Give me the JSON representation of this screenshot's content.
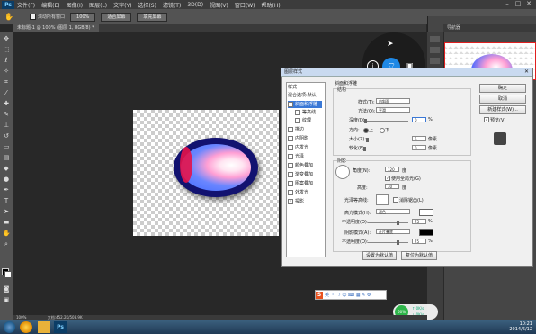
{
  "menubar": {
    "logo": "Ps",
    "items": [
      "文件(F)",
      "编辑(E)",
      "图像(I)",
      "图层(L)",
      "文字(Y)",
      "选择(S)",
      "滤镜(T)",
      "3D(D)",
      "视图(V)",
      "窗口(W)",
      "帮助(H)"
    ],
    "win_controls": [
      "–",
      "□",
      "✕"
    ]
  },
  "options": {
    "hand_icon": "hand-icon",
    "scroll_all_label": "滚动所有窗口",
    "zoom100": "100%",
    "fit_screen": "适合屏幕",
    "fill_screen": "填充屏幕"
  },
  "document": {
    "tab_title": "未标题-1 @ 100% (图层 1, RGB/8) *",
    "zoom": "100%",
    "doc_info": "文档:452.2K/508.9K"
  },
  "panel": {
    "title": "导航器"
  },
  "dialog": {
    "title": "图层样式",
    "styles_header": "样式",
    "blend_default": "混合选项:默认",
    "items": [
      {
        "label": "斜面和浮雕",
        "checked": true,
        "selected": true
      },
      {
        "label": "等高线",
        "checked": false
      },
      {
        "label": "纹理",
        "checked": false
      },
      {
        "label": "描边",
        "checked": false
      },
      {
        "label": "内阴影",
        "checked": false
      },
      {
        "label": "内发光",
        "checked": false
      },
      {
        "label": "光泽",
        "checked": false
      },
      {
        "label": "颜色叠加",
        "checked": false
      },
      {
        "label": "渐变叠加",
        "checked": false
      },
      {
        "label": "图案叠加",
        "checked": false
      },
      {
        "label": "外发光",
        "checked": false
      },
      {
        "label": "投影",
        "checked": true
      }
    ],
    "section_title": "斜面和浮雕",
    "structure": "结构",
    "style_label": "样式(T):",
    "style_value": "内斜面",
    "method_label": "方法(Q):",
    "method_value": "平滑",
    "depth_label": "深度(D):",
    "depth_value": "0",
    "pct": "%",
    "direction_label": "方向:",
    "dir_up": "上",
    "dir_down": "下",
    "size_label": "大小(Z):",
    "size_value": "5",
    "px": "像素",
    "soften_label": "软化(F):",
    "soften_value": "0",
    "shading": "阴影",
    "angle_label": "角度(N):",
    "angle_value": "120",
    "deg": "度",
    "global_light": "使用全局光(G)",
    "altitude_label": "高度:",
    "altitude_value": "30",
    "gloss_label": "光泽等高线:",
    "anti_alias": "消除锯齿(L)",
    "hl_mode_label": "高光模式(H):",
    "hl_mode": "滤色",
    "opacity_label": "不透明度(O):",
    "hl_opacity": "75",
    "sh_mode_label": "阴影模式(A):",
    "sh_mode": "正片叠底",
    "sh_opacity": "75",
    "make_default": "设置为默认值",
    "reset_default": "复位为默认值",
    "ok": "确定",
    "cancel": "取消",
    "new_style": "新建样式(W)...",
    "preview": "预览(V)"
  },
  "ime": {
    "logo": "S",
    "glyphs": "英 ・ ☽ ☺ ⌨ ▦ ✎ ⚙"
  },
  "speed": {
    "pct": "60%",
    "up": "0K/s",
    "down": "0K/s"
  },
  "clock": {
    "time": "10:21",
    "date": "2014/6/12"
  },
  "colors": {
    "accent": "#3a78d6",
    "wifi": "#1e88e5",
    "ellipse_rim": "#121270"
  }
}
